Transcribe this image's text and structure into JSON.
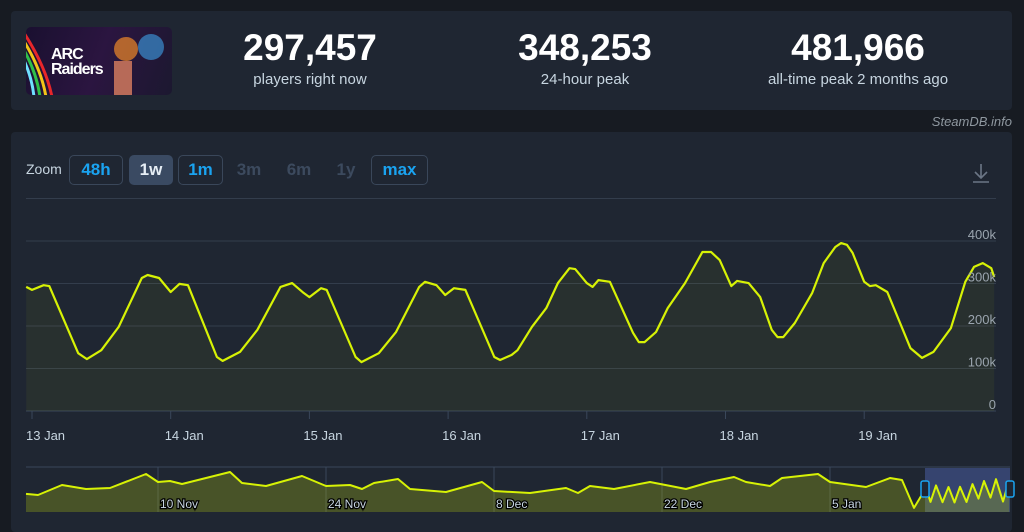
{
  "header": {
    "game_logo_text": "ARC Raiders",
    "stats": [
      {
        "value": "297,457",
        "label": "players right now"
      },
      {
        "value": "348,253",
        "label": "24-hour peak"
      },
      {
        "value": "481,966",
        "label": "all-time peak 2 months ago"
      }
    ]
  },
  "credit": "SteamDB.info",
  "zoom": {
    "label": "Zoom",
    "buttons": [
      {
        "label": "48h",
        "state": "enabled"
      },
      {
        "label": "1w",
        "state": "active"
      },
      {
        "label": "1m",
        "state": "enabled"
      },
      {
        "label": "3m",
        "state": "disabled"
      },
      {
        "label": "6m",
        "state": "disabled"
      },
      {
        "label": "1y",
        "state": "disabled"
      },
      {
        "label": "max",
        "state": "enabled"
      }
    ],
    "download_icon": "download-icon"
  },
  "colors": {
    "line": "#d7f205",
    "accent": "#1aa3f0",
    "selection": "#3b4a7a"
  },
  "chart_data": [
    {
      "type": "line",
      "title": "",
      "xlabel": "",
      "ylabel": "",
      "grid": true,
      "ylim": [
        0,
        500000
      ],
      "y_ticks": [
        "0",
        "100k",
        "200k",
        "300k",
        "400k"
      ],
      "x_ticks": [
        "13 Jan",
        "14 Jan",
        "15 Jan",
        "16 Jan",
        "17 Jan",
        "18 Jan",
        "19 Jan"
      ],
      "points": [
        [
          "12 Jan 23:00",
          292000
        ],
        [
          "13 Jan 00:00",
          285000
        ],
        [
          "13 Jan 02:00",
          296000
        ],
        [
          "13 Jan 03:00",
          294000
        ],
        [
          "13 Jan 08:00",
          136000
        ],
        [
          "13 Jan 09:30",
          122000
        ],
        [
          "13 Jan 12:00",
          143000
        ],
        [
          "13 Jan 15:00",
          198000
        ],
        [
          "13 Jan 19:00",
          313000
        ],
        [
          "13 Jan 20:00",
          320000
        ],
        [
          "13 Jan 22:00",
          313000
        ],
        [
          "14 Jan 00:00",
          280000
        ],
        [
          "14 Jan 01:30",
          299000
        ],
        [
          "14 Jan 03:00",
          296000
        ],
        [
          "14 Jan 08:00",
          127000
        ],
        [
          "14 Jan 09:00",
          118000
        ],
        [
          "14 Jan 12:00",
          139000
        ],
        [
          "14 Jan 15:00",
          191000
        ],
        [
          "14 Jan 19:00",
          292000
        ],
        [
          "14 Jan 21:00",
          301000
        ],
        [
          "14 Jan 23:00",
          278000
        ],
        [
          "15 Jan 00:00",
          268000
        ],
        [
          "15 Jan 02:00",
          289000
        ],
        [
          "15 Jan 03:00",
          285000
        ],
        [
          "15 Jan 08:00",
          127000
        ],
        [
          "15 Jan 09:00",
          115000
        ],
        [
          "15 Jan 12:00",
          136000
        ],
        [
          "15 Jan 15:00",
          186000
        ],
        [
          "15 Jan 19:00",
          292000
        ],
        [
          "15 Jan 20:00",
          304000
        ],
        [
          "15 Jan 22:00",
          296000
        ],
        [
          "15 Jan 23:30",
          273000
        ],
        [
          "16 Jan 01:00",
          289000
        ],
        [
          "16 Jan 03:00",
          285000
        ],
        [
          "16 Jan 08:00",
          127000
        ],
        [
          "16 Jan 09:00",
          120000
        ],
        [
          "16 Jan 11:00",
          132000
        ],
        [
          "16 Jan 12:00",
          143000
        ],
        [
          "16 Jan 14:30",
          198000
        ],
        [
          "16 Jan 17:00",
          242000
        ],
        [
          "16 Jan 19:00",
          301000
        ],
        [
          "16 Jan 21:00",
          336000
        ],
        [
          "16 Jan 22:00",
          334000
        ],
        [
          "17 Jan 00:00",
          301000
        ],
        [
          "17 Jan 01:00",
          292000
        ],
        [
          "17 Jan 02:00",
          308000
        ],
        [
          "17 Jan 04:00",
          304000
        ],
        [
          "17 Jan 08:00",
          184000
        ],
        [
          "17 Jan 09:00",
          162000
        ],
        [
          "17 Jan 10:00",
          162000
        ],
        [
          "17 Jan 12:00",
          186000
        ],
        [
          "17 Jan 14:00",
          242000
        ],
        [
          "17 Jan 17:00",
          301000
        ],
        [
          "17 Jan 20:00",
          374000
        ],
        [
          "17 Jan 21:30",
          374000
        ],
        [
          "17 Jan 23:00",
          355000
        ],
        [
          "18 Jan 01:00",
          294000
        ],
        [
          "18 Jan 02:00",
          306000
        ],
        [
          "18 Jan 04:00",
          301000
        ],
        [
          "18 Jan 06:00",
          268000
        ],
        [
          "18 Jan 08:00",
          191000
        ],
        [
          "18 Jan 09:00",
          174000
        ],
        [
          "18 Jan 10:00",
          174000
        ],
        [
          "18 Jan 12:00",
          207000
        ],
        [
          "18 Jan 15:00",
          278000
        ],
        [
          "18 Jan 17:00",
          348000
        ],
        [
          "18 Jan 19:00",
          386000
        ],
        [
          "18 Jan 20:00",
          395000
        ],
        [
          "18 Jan 21:00",
          391000
        ],
        [
          "18 Jan 22:00",
          372000
        ],
        [
          "19 Jan 00:00",
          304000
        ],
        [
          "19 Jan 01:00",
          294000
        ],
        [
          "19 Jan 02:00",
          296000
        ],
        [
          "19 Jan 04:00",
          280000
        ],
        [
          "19 Jan 08:00",
          148000
        ],
        [
          "19 Jan 10:00",
          125000
        ],
        [
          "19 Jan 12:00",
          139000
        ],
        [
          "19 Jan 15:00",
          195000
        ],
        [
          "19 Jan 17:30",
          304000
        ],
        [
          "19 Jan 19:00",
          339000
        ],
        [
          "19 Jan 20:30",
          348000
        ],
        [
          "19 Jan 22:00",
          336000
        ],
        [
          "19 Jan 22:30",
          315000
        ]
      ]
    },
    {
      "type": "area",
      "role": "navigator",
      "x_ticks": [
        "10 Nov",
        "24 Nov",
        "8 Dec",
        "22 Dec",
        "5 Jan"
      ],
      "selected_range": [
        "13 Jan",
        "20 Jan"
      ],
      "points": [
        [
          "30 Oct",
          218000
        ],
        [
          "31 Oct",
          205000
        ],
        [
          "2 Nov",
          325000
        ],
        [
          "4 Nov",
          277000
        ],
        [
          "6 Nov",
          289000
        ],
        [
          "9 Nov",
          458000
        ],
        [
          "10 Nov",
          361000
        ],
        [
          "11 Nov",
          373000
        ],
        [
          "12 Nov",
          337000
        ],
        [
          "16 Nov",
          482000
        ],
        [
          "17 Nov",
          349000
        ],
        [
          "19 Nov",
          313000
        ],
        [
          "22 Nov",
          434000
        ],
        [
          "24 Nov",
          313000
        ],
        [
          "26 Nov",
          325000
        ],
        [
          "27 Nov",
          277000
        ],
        [
          "28 Nov",
          349000
        ],
        [
          "30 Nov",
          398000
        ],
        [
          "1 Dec",
          277000
        ],
        [
          "4 Dec",
          241000
        ],
        [
          "7 Dec",
          361000
        ],
        [
          "8 Dec",
          253000
        ],
        [
          "11 Dec",
          229000
        ],
        [
          "14 Dec",
          289000
        ],
        [
          "15 Dec",
          229000
        ],
        [
          "16 Dec",
          313000
        ],
        [
          "18 Dec",
          277000
        ],
        [
          "21 Dec",
          361000
        ],
        [
          "24 Dec",
          277000
        ],
        [
          "26 Dec",
          361000
        ],
        [
          "28 Dec",
          422000
        ],
        [
          "29 Dec",
          361000
        ],
        [
          "31 Dec",
          313000
        ],
        [
          "1 Jan",
          410000
        ],
        [
          "4 Jan",
          458000
        ],
        [
          "5 Jan",
          361000
        ],
        [
          "8 Jan",
          301000
        ],
        [
          "10 Jan",
          410000
        ],
        [
          "11 Jan",
          386000
        ],
        [
          "12 Jan",
          50000
        ],
        [
          "13 Jan",
          290000
        ],
        [
          "13 Jan 09:00",
          122000
        ],
        [
          "13 Jan 20:00",
          320000
        ],
        [
          "14 Jan 09:00",
          118000
        ],
        [
          "14 Jan 21:00",
          301000
        ],
        [
          "15 Jan 09:00",
          115000
        ],
        [
          "15 Jan 20:00",
          304000
        ],
        [
          "16 Jan 09:00",
          120000
        ],
        [
          "16 Jan 21:00",
          336000
        ],
        [
          "17 Jan 09:00",
          162000
        ],
        [
          "17 Jan 20:00",
          374000
        ],
        [
          "18 Jan 09:00",
          174000
        ],
        [
          "18 Jan 20:00",
          395000
        ],
        [
          "19 Jan 10:00",
          125000
        ],
        [
          "19 Jan 20:30",
          348000
        ],
        [
          "19 Jan 22:30",
          315000
        ]
      ]
    }
  ]
}
